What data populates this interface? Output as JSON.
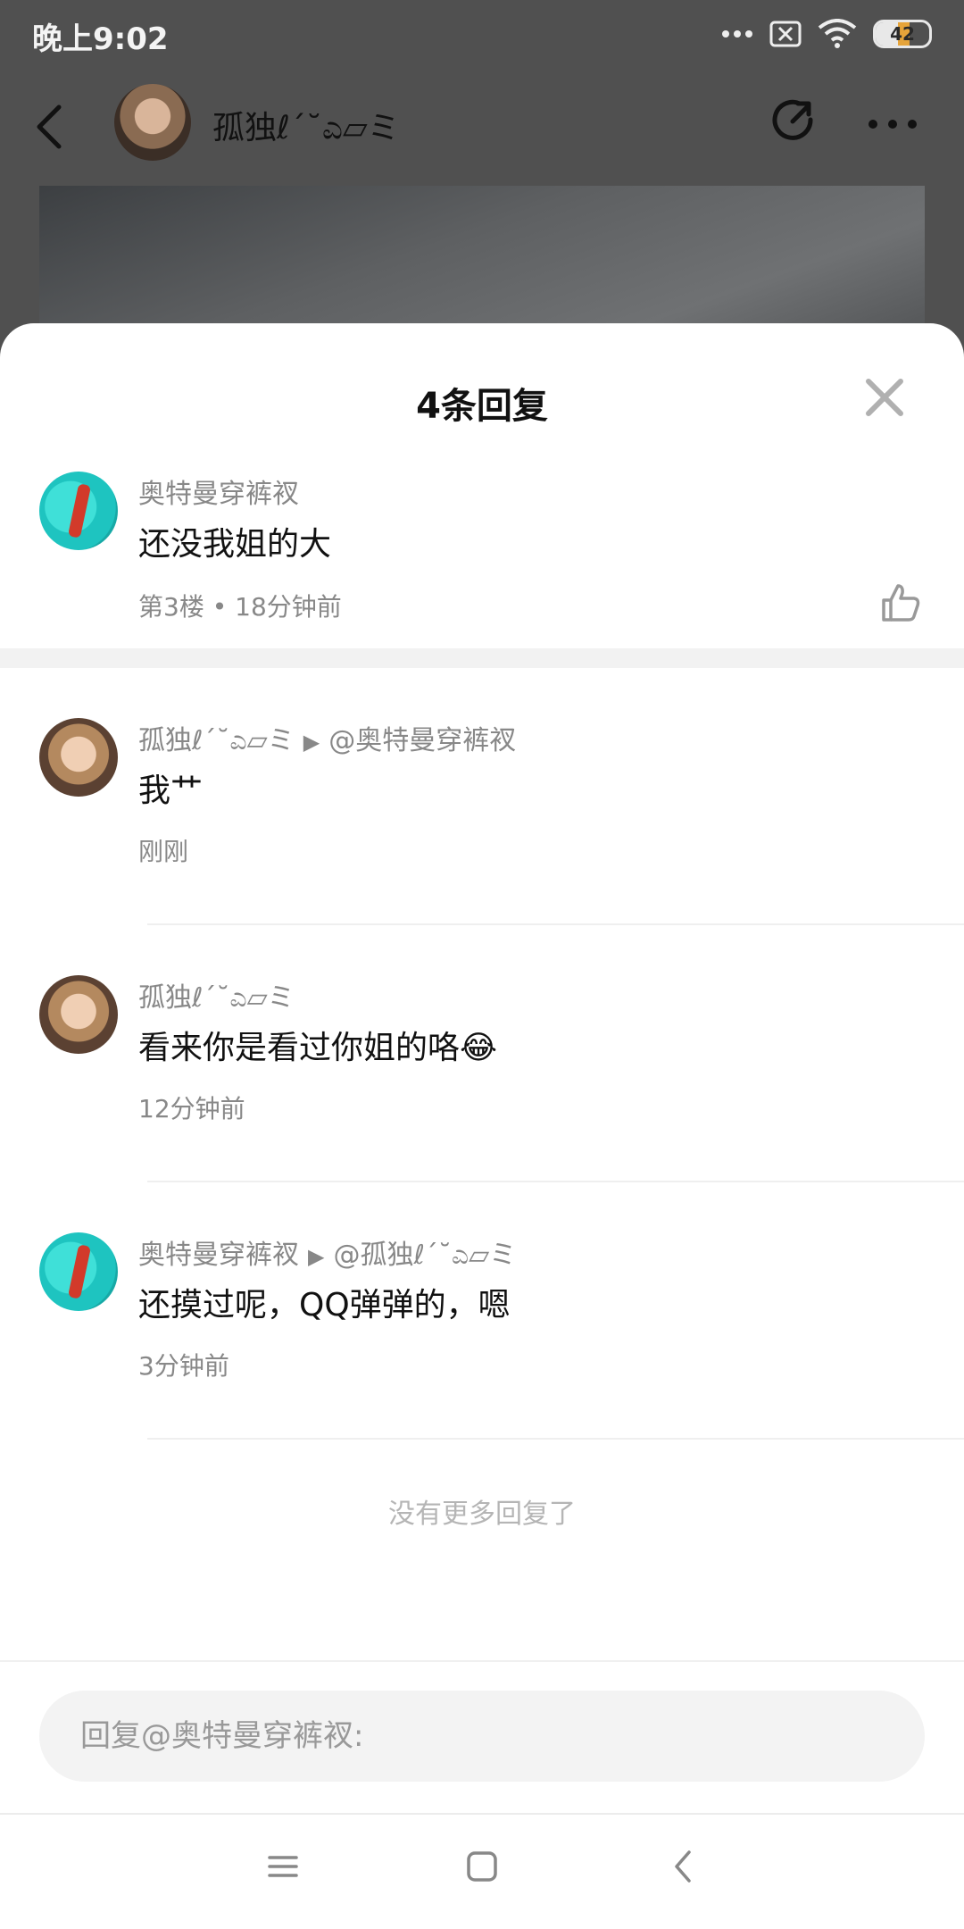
{
  "status_bar": {
    "time": "晚上9:02",
    "battery_level": "42",
    "icons": [
      "more-dots-icon",
      "sim-off-icon",
      "wifi-icon",
      "battery-icon"
    ]
  },
  "post_header": {
    "author_name": "孤独ℓ΄˘ಎ▱ミ",
    "icons": [
      "back-arrow-icon",
      "share-icon",
      "more-dots-icon"
    ]
  },
  "sheet": {
    "title": "4条回复",
    "close_icon": "close-icon",
    "main_comment": {
      "author": "奥特曼穿裤衩",
      "text": "还没我姐的大",
      "meta": "第3楼 • 18分钟前",
      "like_icon": "thumbs-up-icon"
    },
    "replies": [
      {
        "author": "孤独ℓ΄˘ಎ▱ミ",
        "arrow": "▶",
        "reply_to": "@奥特曼穿裤衩",
        "text": "我艹",
        "time": "刚刚"
      },
      {
        "author": "孤独ℓ΄˘ಎ▱ミ",
        "arrow": "",
        "reply_to": "",
        "text": "看来你是看过你姐的咯😂",
        "time": "12分钟前"
      },
      {
        "author": "奥特曼穿裤衩",
        "arrow": "▶",
        "reply_to": "@孤独ℓ΄˘ಎ▱ミ",
        "text": "还摸过呢，QQ弹弹的，嗯",
        "time": "3分钟前"
      }
    ],
    "no_more": "没有更多回复了",
    "reply_placeholder": "回复@奥特曼穿裤衩:"
  },
  "nav_bar": {
    "icons": [
      "menu-icon",
      "home-icon",
      "back-icon"
    ]
  }
}
